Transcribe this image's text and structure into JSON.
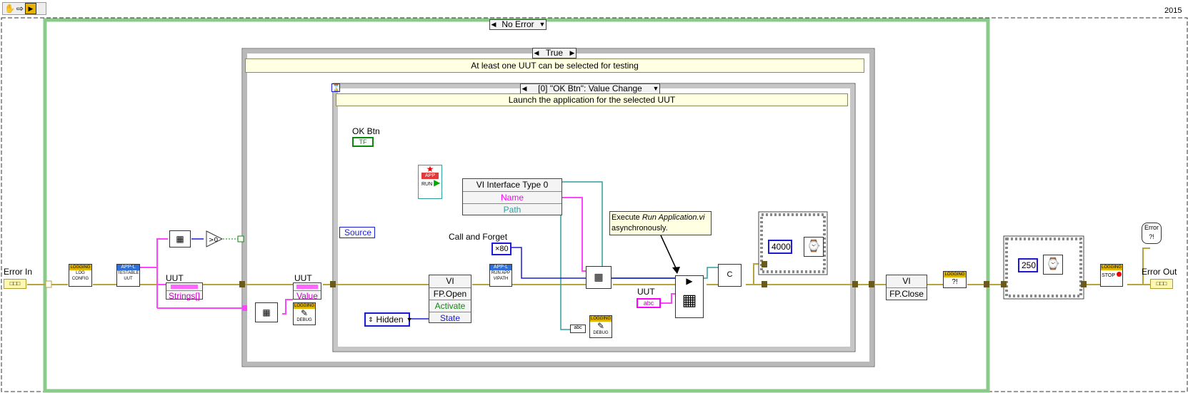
{
  "toolbar": {
    "icons": [
      "hand-icon",
      "arrow-icon",
      "labview-icon"
    ]
  },
  "version": "2015",
  "cases": {
    "outer": "No Error",
    "inner": "True",
    "inner_label": "At least one UUT can be selected for testing"
  },
  "event": {
    "selector": "[0] \"OK Btn\": Value Change",
    "label": "Launch the application for the selected UUT"
  },
  "labels": {
    "error_in": "Error In",
    "error_out": "Error Out",
    "uut1": "UUT",
    "uut2": "UUT",
    "uut3": "UUT",
    "ok_btn": "OK Btn",
    "ok_btn_glyph": "TF",
    "source": "Source",
    "call_and_forget": "Call and Forget"
  },
  "nodes": {
    "logging": "LOGGING",
    "log_config": "LOG CONFIG",
    "app_l": "APP-L",
    "testable_uut": "TESTABLE UUT",
    "strings": "Strings[]",
    "value": "Value",
    "debug": "DEBUG",
    "app": "APP",
    "run": "RUN",
    "run_app_vipath": "RUN APP VIPATH",
    "vi_interface": "VI Interface Type 0",
    "name": "Name",
    "path": "Path",
    "vi": "VI",
    "fp_open": "FP.Open",
    "activate": "Activate",
    "state": "State",
    "fp_close": "FP.Close",
    "stop": "STOP",
    "error_glyph": "Error",
    "abc": "abc",
    "constant_c": "C"
  },
  "constants": {
    "call_forget": "×80",
    "hidden": "Hidden",
    "wait1": "4000",
    "wait2": "250"
  },
  "comment": {
    "prefix": "Execute ",
    "italic": "Run Application.vi",
    "suffix": "asynchronously."
  },
  "colors": {
    "error_wire": "#b8a33c",
    "string_wire": "#ff00ff",
    "ref_wire": "#2f9e9e",
    "numeric_wire": "#1b1bd6",
    "case_border": "#8acb8a"
  }
}
